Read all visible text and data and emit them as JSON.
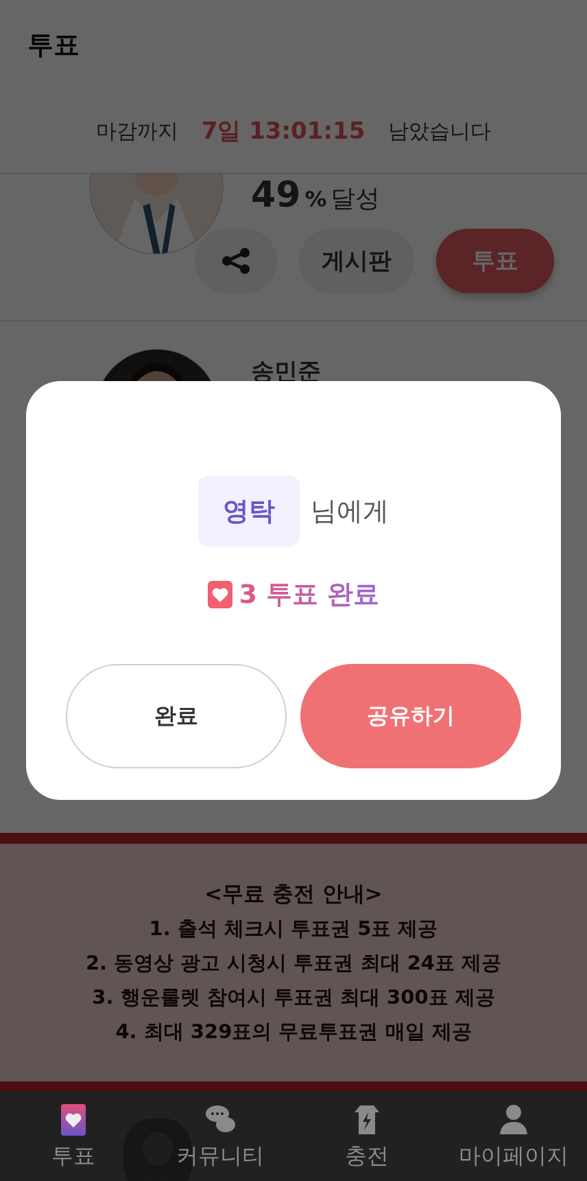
{
  "header": {
    "title": "투표"
  },
  "countdown": {
    "prefix": "마감까지",
    "time": "7일 13:01:15",
    "suffix": "남았습니다"
  },
  "first_card": {
    "progress": "49",
    "unit": "%",
    "progress_label": "달성",
    "buttons": [
      {
        "kind": "share"
      },
      {
        "kind": "board",
        "label": "게시판"
      },
      {
        "kind": "vote",
        "label": "투표"
      }
    ]
  },
  "second_card": {
    "name": "송민준"
  },
  "banner": {
    "title": "<무료 충전 안내>",
    "lines": [
      "1. 출석 체크시 투표권 5표 제공",
      "2. 동영상 광고 시청시 투표권 최대 24표 제공",
      "3. 행운룰렛 참여시 투표권 최대 300표 제공",
      "4. 최대 329표의 무료투표권 매일 제공"
    ]
  },
  "nav": [
    {
      "label": "투표",
      "selected": true
    },
    {
      "label": "커뮤니티",
      "selected": false
    },
    {
      "label": "충전",
      "selected": false
    },
    {
      "label": "마이페이지",
      "selected": false
    }
  ],
  "modal": {
    "recipient": "영탁",
    "recipient_suffix": "님에게",
    "result": "3 투표 완료",
    "buttons": [
      {
        "kind": "secondary",
        "label": "완료"
      },
      {
        "kind": "primary",
        "label": "공유하기"
      }
    ]
  }
}
